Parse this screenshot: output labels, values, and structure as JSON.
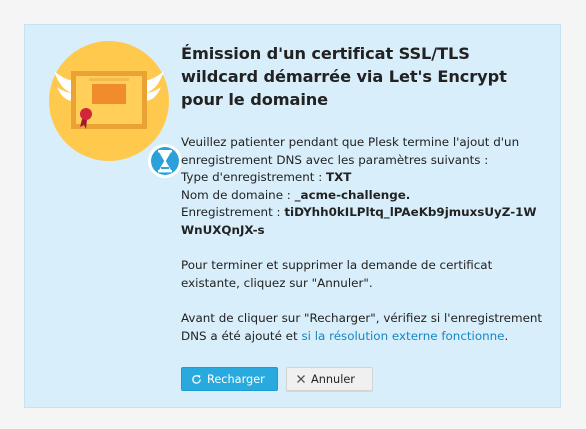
{
  "dialog": {
    "title": "Émission d'un certificat SSL/TLS wildcard démarrée via Let's Encrypt pour le domaine",
    "intro": "Veuillez patienter pendant que Plesk termine l'ajout d'un enregistrement DNS avec les paramètres suivants :",
    "record_type_label": "Type d'enregistrement :",
    "record_type_value": "TXT",
    "domain_name_label": "Nom de domaine :",
    "domain_name_value": "_acme-challenge.",
    "record_label": "Enregistrement :",
    "record_value": "tiDYhh0kILPltq_lPAeKb9jmuxsUyZ-1WWnUXQnJX-s",
    "cancel_info": "Pour terminer et supprimer la demande de certificat existante, cliquez sur \"Annuler\".",
    "reload_info_prefix": "Avant de cliquer sur \"Recharger\", vérifiez si l'enregistrement DNS a été ajouté et ",
    "reload_info_link": "si la résolution externe fonctionne",
    "reload_info_suffix": "."
  },
  "buttons": {
    "reload_label": "Recharger",
    "cancel_label": "Annuler"
  },
  "icons": {
    "illustration": "certificate-hourglass-icon",
    "reload": "refresh-icon",
    "cancel": "close-icon"
  },
  "colors": {
    "panel_bg": "#d8eefa",
    "primary_button": "#28aade",
    "link": "#1587c6"
  }
}
